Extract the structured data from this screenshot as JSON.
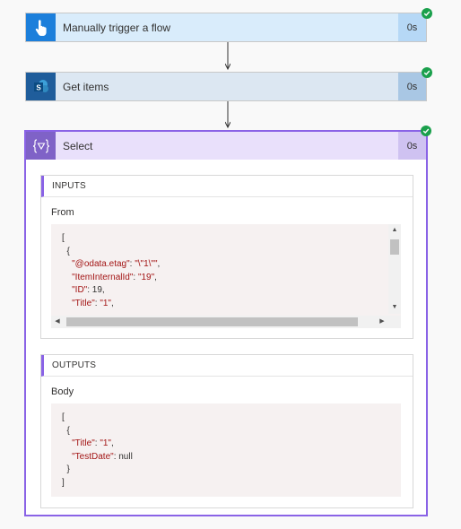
{
  "steps": [
    {
      "title": "Manually trigger a flow",
      "duration": "0s",
      "icon": "hand-pointer-icon",
      "color": "#1c7fdb"
    },
    {
      "title": "Get items",
      "duration": "0s",
      "icon": "sharepoint-icon",
      "color": "#1f5d9b"
    }
  ],
  "select": {
    "title": "Select",
    "duration": "0s",
    "icon": "select-braces-icon",
    "accent": "#8a63e6",
    "inputs": {
      "heading": "INPUTS",
      "field_label": "From",
      "lines": [
        {
          "p": "[",
          "k": "",
          "v": ""
        },
        {
          "p": "  {",
          "k": "",
          "v": ""
        },
        {
          "p": "    ",
          "k": "\"@odata.etag\"",
          "v": ": \"\\\"1\\\"\","
        },
        {
          "p": "    ",
          "k": "\"ItemInternalId\"",
          "v": ": \"19\","
        },
        {
          "p": "    ",
          "k": "\"ID\"",
          "v": ": 19,"
        },
        {
          "p": "    ",
          "k": "\"Title\"",
          "v": ": \"1\","
        }
      ]
    },
    "outputs": {
      "heading": "OUTPUTS",
      "field_label": "Body",
      "lines": [
        {
          "p": "[",
          "k": "",
          "v": ""
        },
        {
          "p": "  {",
          "k": "",
          "v": ""
        },
        {
          "p": "    ",
          "k": "\"Title\"",
          "v": ": \"1\","
        },
        {
          "p": "    ",
          "k": "\"TestDate\"",
          "v": ": null"
        },
        {
          "p": "  }",
          "k": "",
          "v": ""
        },
        {
          "p": "]",
          "k": "",
          "v": ""
        }
      ]
    }
  },
  "status_color": "#1aa04c"
}
